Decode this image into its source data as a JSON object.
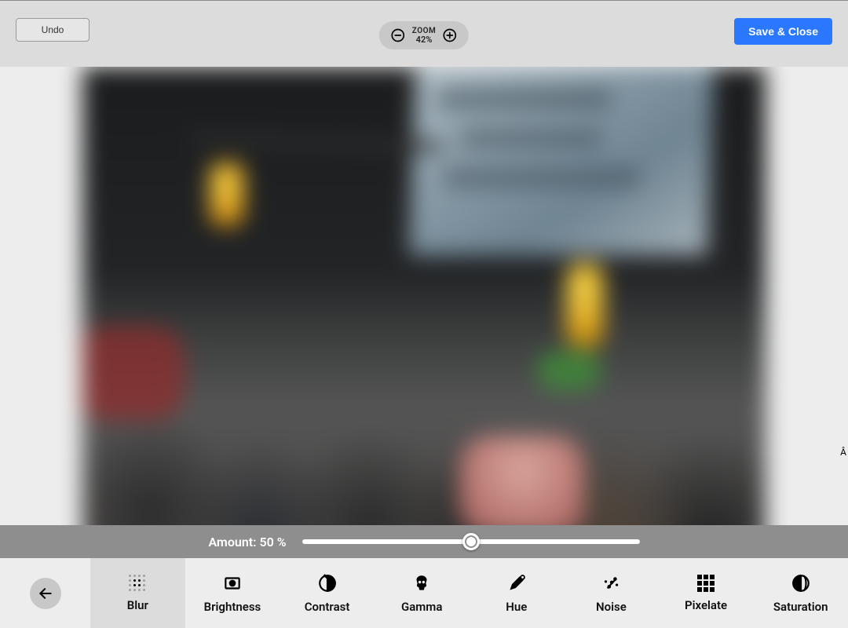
{
  "header": {
    "undo_label": "Undo",
    "zoom_label": "ZOOM",
    "zoom_value": "42%",
    "save_label": "Save & Close"
  },
  "amount": {
    "label_prefix": "Amount: ",
    "value": "50 %",
    "percent": 50
  },
  "tools": {
    "active_index": 0,
    "items": [
      {
        "key": "blur",
        "label": "Blur",
        "icon": "blur-icon"
      },
      {
        "key": "brightness",
        "label": "Brightness",
        "icon": "brightness-icon"
      },
      {
        "key": "contrast",
        "label": "Contrast",
        "icon": "contrast-icon"
      },
      {
        "key": "gamma",
        "label": "Gamma",
        "icon": "gamma-icon"
      },
      {
        "key": "hue",
        "label": "Hue",
        "icon": "hue-icon"
      },
      {
        "key": "noise",
        "label": "Noise",
        "icon": "noise-icon"
      },
      {
        "key": "pixelate",
        "label": "Pixelate",
        "icon": "pixelate-icon"
      },
      {
        "key": "saturation",
        "label": "Saturation",
        "icon": "saturation-icon"
      }
    ]
  },
  "colors": {
    "primary": "#2a78ff"
  },
  "stray_char": "Â"
}
